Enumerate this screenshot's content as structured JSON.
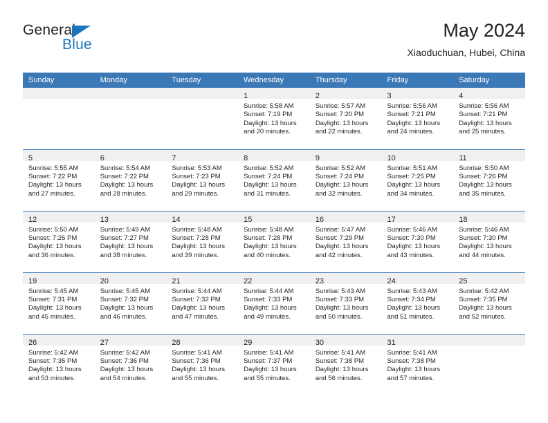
{
  "brand": {
    "name_top": "General",
    "name_bottom": "Blue",
    "accent_color": "#1b75bc"
  },
  "header": {
    "title": "May 2024",
    "subtitle": "Xiaoduchuan, Hubei, China"
  },
  "theme": {
    "header_band": "#3b78b6",
    "daynum_band": "#f0f0f0",
    "text": "#231f20"
  },
  "weekday_headers": [
    "Sunday",
    "Monday",
    "Tuesday",
    "Wednesday",
    "Thursday",
    "Friday",
    "Saturday"
  ],
  "labels": {
    "sunrise_prefix": "Sunrise:",
    "sunset_prefix": "Sunset:",
    "daylight_prefix": "Daylight:"
  },
  "weeks": [
    [
      {
        "empty": true
      },
      {
        "empty": true
      },
      {
        "empty": true
      },
      {
        "day": "1",
        "sunrise": "Sunrise: 5:58 AM",
        "sunset": "Sunset: 7:19 PM",
        "daylight1": "Daylight: 13 hours",
        "daylight2": "and 20 minutes."
      },
      {
        "day": "2",
        "sunrise": "Sunrise: 5:57 AM",
        "sunset": "Sunset: 7:20 PM",
        "daylight1": "Daylight: 13 hours",
        "daylight2": "and 22 minutes."
      },
      {
        "day": "3",
        "sunrise": "Sunrise: 5:56 AM",
        "sunset": "Sunset: 7:21 PM",
        "daylight1": "Daylight: 13 hours",
        "daylight2": "and 24 minutes."
      },
      {
        "day": "4",
        "sunrise": "Sunrise: 5:56 AM",
        "sunset": "Sunset: 7:21 PM",
        "daylight1": "Daylight: 13 hours",
        "daylight2": "and 25 minutes."
      }
    ],
    [
      {
        "day": "5",
        "sunrise": "Sunrise: 5:55 AM",
        "sunset": "Sunset: 7:22 PM",
        "daylight1": "Daylight: 13 hours",
        "daylight2": "and 27 minutes."
      },
      {
        "day": "6",
        "sunrise": "Sunrise: 5:54 AM",
        "sunset": "Sunset: 7:22 PM",
        "daylight1": "Daylight: 13 hours",
        "daylight2": "and 28 minutes."
      },
      {
        "day": "7",
        "sunrise": "Sunrise: 5:53 AM",
        "sunset": "Sunset: 7:23 PM",
        "daylight1": "Daylight: 13 hours",
        "daylight2": "and 29 minutes."
      },
      {
        "day": "8",
        "sunrise": "Sunrise: 5:52 AM",
        "sunset": "Sunset: 7:24 PM",
        "daylight1": "Daylight: 13 hours",
        "daylight2": "and 31 minutes."
      },
      {
        "day": "9",
        "sunrise": "Sunrise: 5:52 AM",
        "sunset": "Sunset: 7:24 PM",
        "daylight1": "Daylight: 13 hours",
        "daylight2": "and 32 minutes."
      },
      {
        "day": "10",
        "sunrise": "Sunrise: 5:51 AM",
        "sunset": "Sunset: 7:25 PM",
        "daylight1": "Daylight: 13 hours",
        "daylight2": "and 34 minutes."
      },
      {
        "day": "11",
        "sunrise": "Sunrise: 5:50 AM",
        "sunset": "Sunset: 7:26 PM",
        "daylight1": "Daylight: 13 hours",
        "daylight2": "and 35 minutes."
      }
    ],
    [
      {
        "day": "12",
        "sunrise": "Sunrise: 5:50 AM",
        "sunset": "Sunset: 7:26 PM",
        "daylight1": "Daylight: 13 hours",
        "daylight2": "and 36 minutes."
      },
      {
        "day": "13",
        "sunrise": "Sunrise: 5:49 AM",
        "sunset": "Sunset: 7:27 PM",
        "daylight1": "Daylight: 13 hours",
        "daylight2": "and 38 minutes."
      },
      {
        "day": "14",
        "sunrise": "Sunrise: 5:48 AM",
        "sunset": "Sunset: 7:28 PM",
        "daylight1": "Daylight: 13 hours",
        "daylight2": "and 39 minutes."
      },
      {
        "day": "15",
        "sunrise": "Sunrise: 5:48 AM",
        "sunset": "Sunset: 7:28 PM",
        "daylight1": "Daylight: 13 hours",
        "daylight2": "and 40 minutes."
      },
      {
        "day": "16",
        "sunrise": "Sunrise: 5:47 AM",
        "sunset": "Sunset: 7:29 PM",
        "daylight1": "Daylight: 13 hours",
        "daylight2": "and 42 minutes."
      },
      {
        "day": "17",
        "sunrise": "Sunrise: 5:46 AM",
        "sunset": "Sunset: 7:30 PM",
        "daylight1": "Daylight: 13 hours",
        "daylight2": "and 43 minutes."
      },
      {
        "day": "18",
        "sunrise": "Sunrise: 5:46 AM",
        "sunset": "Sunset: 7:30 PM",
        "daylight1": "Daylight: 13 hours",
        "daylight2": "and 44 minutes."
      }
    ],
    [
      {
        "day": "19",
        "sunrise": "Sunrise: 5:45 AM",
        "sunset": "Sunset: 7:31 PM",
        "daylight1": "Daylight: 13 hours",
        "daylight2": "and 45 minutes."
      },
      {
        "day": "20",
        "sunrise": "Sunrise: 5:45 AM",
        "sunset": "Sunset: 7:32 PM",
        "daylight1": "Daylight: 13 hours",
        "daylight2": "and 46 minutes."
      },
      {
        "day": "21",
        "sunrise": "Sunrise: 5:44 AM",
        "sunset": "Sunset: 7:32 PM",
        "daylight1": "Daylight: 13 hours",
        "daylight2": "and 47 minutes."
      },
      {
        "day": "22",
        "sunrise": "Sunrise: 5:44 AM",
        "sunset": "Sunset: 7:33 PM",
        "daylight1": "Daylight: 13 hours",
        "daylight2": "and 49 minutes."
      },
      {
        "day": "23",
        "sunrise": "Sunrise: 5:43 AM",
        "sunset": "Sunset: 7:33 PM",
        "daylight1": "Daylight: 13 hours",
        "daylight2": "and 50 minutes."
      },
      {
        "day": "24",
        "sunrise": "Sunrise: 5:43 AM",
        "sunset": "Sunset: 7:34 PM",
        "daylight1": "Daylight: 13 hours",
        "daylight2": "and 51 minutes."
      },
      {
        "day": "25",
        "sunrise": "Sunrise: 5:42 AM",
        "sunset": "Sunset: 7:35 PM",
        "daylight1": "Daylight: 13 hours",
        "daylight2": "and 52 minutes."
      }
    ],
    [
      {
        "day": "26",
        "sunrise": "Sunrise: 5:42 AM",
        "sunset": "Sunset: 7:35 PM",
        "daylight1": "Daylight: 13 hours",
        "daylight2": "and 53 minutes."
      },
      {
        "day": "27",
        "sunrise": "Sunrise: 5:42 AM",
        "sunset": "Sunset: 7:36 PM",
        "daylight1": "Daylight: 13 hours",
        "daylight2": "and 54 minutes."
      },
      {
        "day": "28",
        "sunrise": "Sunrise: 5:41 AM",
        "sunset": "Sunset: 7:36 PM",
        "daylight1": "Daylight: 13 hours",
        "daylight2": "and 55 minutes."
      },
      {
        "day": "29",
        "sunrise": "Sunrise: 5:41 AM",
        "sunset": "Sunset: 7:37 PM",
        "daylight1": "Daylight: 13 hours",
        "daylight2": "and 55 minutes."
      },
      {
        "day": "30",
        "sunrise": "Sunrise: 5:41 AM",
        "sunset": "Sunset: 7:38 PM",
        "daylight1": "Daylight: 13 hours",
        "daylight2": "and 56 minutes."
      },
      {
        "day": "31",
        "sunrise": "Sunrise: 5:41 AM",
        "sunset": "Sunset: 7:38 PM",
        "daylight1": "Daylight: 13 hours",
        "daylight2": "and 57 minutes."
      },
      {
        "empty": true
      }
    ]
  ]
}
